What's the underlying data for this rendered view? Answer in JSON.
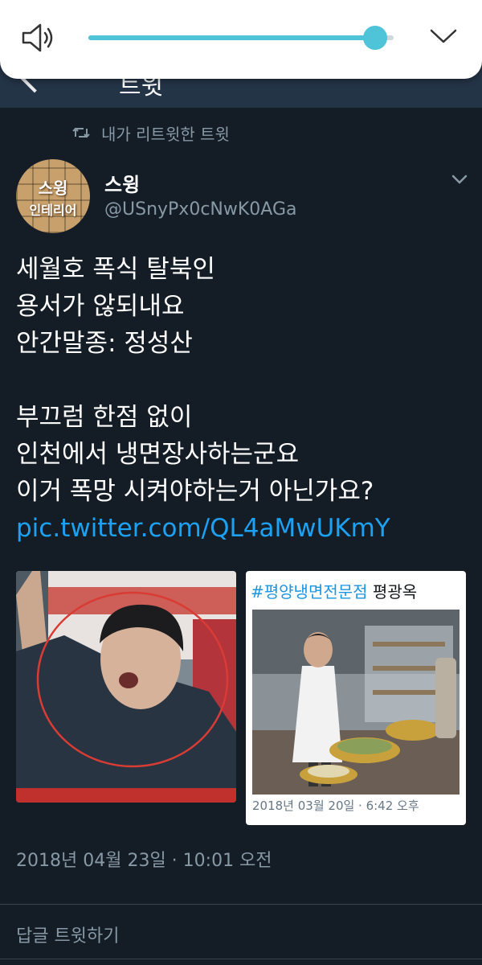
{
  "header": {
    "title_fragment": "트윗"
  },
  "volume": {
    "level": 0.94
  },
  "retweet": {
    "label": "내가 리트윗한 트윗"
  },
  "author": {
    "avatar_text_top": "스윙",
    "avatar_text_bottom": "인테리어",
    "name": "스윙",
    "handle": "@USnyPx0cNwK0AGa"
  },
  "tweet": {
    "lines_block1": [
      "세월호 폭식 탈북인",
      "용서가 않되내요",
      "안간말종: 정성산"
    ],
    "lines_block2": [
      "부끄럼 한점 없이",
      "인천에서 냉면장사하는군요",
      "이거 폭망 시켜야하는거 아닌가요?"
    ],
    "link": "pic.twitter.com/QL4aMwUKmY",
    "timestamp": "2018년 04월 23일 · 10:01 오전"
  },
  "media": {
    "right": {
      "hashtag": "#평양냉면전문점",
      "name": "평광옥",
      "date": "2018년 03월 20일 · 6:42 오후"
    }
  },
  "reply": {
    "label": "답글 트윗하기"
  },
  "colors": {
    "bg": "#141d26",
    "bar": "#243447",
    "accent": "#1da1f2",
    "muted": "#8899a6",
    "volume": "#4fc3d7"
  }
}
